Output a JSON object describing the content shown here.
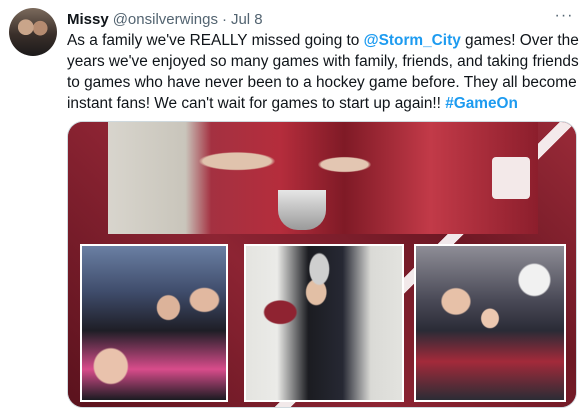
{
  "tweet": {
    "author": {
      "name": "Missy",
      "handle": "@onsilverwings",
      "separator": "·",
      "date": "Jul 8"
    },
    "more_icon": "···",
    "text": {
      "line1_a": "As a family we've REALLY missed going to ",
      "line1_mention": "@Storm_City",
      "line1_b": " games! Over the",
      "line2": "years we've enjoyed so many games with family, friends, and taking friends",
      "line3": "to games who have never been to a hockey game before. They all become",
      "line4_a": "instant fans! We can't wait for games to start up again!! ",
      "line4_hashtag": "#GameOn"
    },
    "colors": {
      "link": "#1d9bf0",
      "text": "#0f1419",
      "secondary": "#536471",
      "collage_maroon": "#7d1f2d"
    }
  }
}
